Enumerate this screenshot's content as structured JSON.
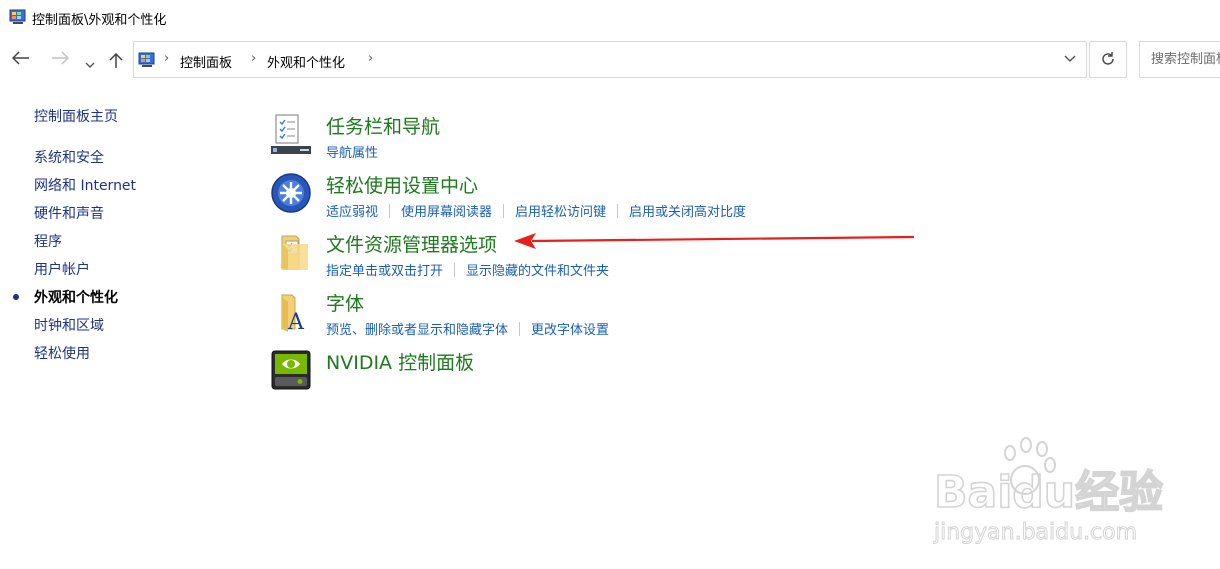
{
  "window": {
    "title": "控制面板\\外观和个性化"
  },
  "navigation": {
    "back_icon": "back-arrow-icon",
    "forward_icon": "forward-arrow-icon",
    "recent_icon": "chevron-down-icon",
    "up_icon": "up-arrow-icon",
    "breadcrumbs": [
      "控制面板",
      "外观和个性化"
    ],
    "search_placeholder": "搜索控制面板"
  },
  "sidebar": {
    "home": "控制面板主页",
    "items": [
      "系统和安全",
      "网络和 Internet",
      "硬件和声音",
      "程序",
      "用户帐户",
      "外观和个性化",
      "时钟和区域",
      "轻松使用"
    ],
    "current_index": 5
  },
  "categories": [
    {
      "title": "任务栏和导航",
      "icon": "taskbar-icon",
      "links": [
        "导航属性"
      ]
    },
    {
      "title": "轻松使用设置中心",
      "icon": "ease-of-access-icon",
      "links": [
        "适应弱视",
        "使用屏幕阅读器",
        "启用轻松访问键",
        "启用或关闭高对比度"
      ]
    },
    {
      "title": "文件资源管理器选项",
      "icon": "folder-options-icon",
      "links": [
        "指定单击或双击打开",
        "显示隐藏的文件和文件夹"
      ]
    },
    {
      "title": "字体",
      "icon": "fonts-folder-icon",
      "links": [
        "预览、删除或者显示和隐藏字体",
        "更改字体设置"
      ]
    },
    {
      "title": "NVIDIA 控制面板",
      "icon": "nvidia-icon",
      "links": []
    }
  ],
  "annotation": {
    "arrow_color": "#e8201c"
  },
  "watermark": {
    "brand": "Baidu经验",
    "url": "jingyan.baidu.com"
  }
}
